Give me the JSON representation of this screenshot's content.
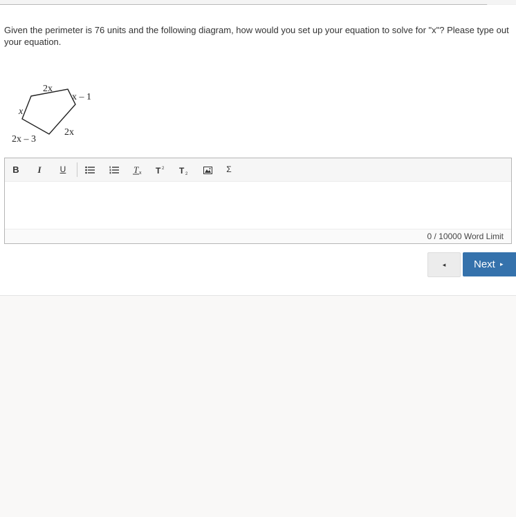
{
  "question": {
    "text": "Given the perimeter is 76 units and the following diagram, how would you set up your equation to solve for \"x\"?  Please type out your equation."
  },
  "diagram": {
    "shape": "pentagon",
    "side_labels": {
      "top": "2x",
      "top_right": "x – 1",
      "right": "2x",
      "bottom_left": "2x – 3",
      "left": "x"
    }
  },
  "editor": {
    "toolbar": {
      "bold": "B",
      "italic": "I",
      "underline": "U",
      "bulleted_list": "bulleted-list-icon",
      "numbered_list": "numbered-list-icon",
      "clear_format": "clear-formatting-icon",
      "superscript": "superscript-icon",
      "subscript": "subscript-icon",
      "image": "insert-image-icon",
      "equation": "Σ"
    },
    "content": "",
    "word_count": "0 / 10000 Word Limit"
  },
  "navigation": {
    "prev_label": "◂",
    "next_label": "Next",
    "next_arrow": "▸",
    "next_color": "#3572ac"
  }
}
